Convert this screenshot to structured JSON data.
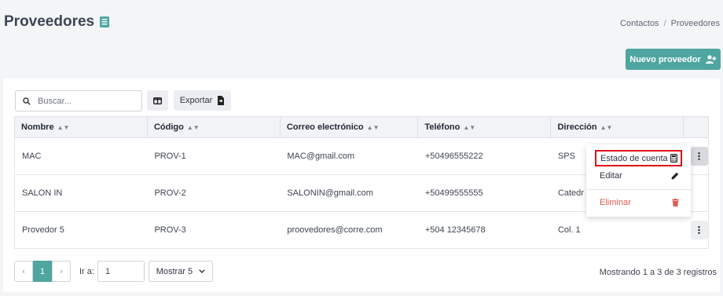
{
  "header": {
    "title": "Proveedores",
    "breadcrumb": [
      "Contactos",
      "Proveedores"
    ],
    "new_button": "Nuevo proveedor"
  },
  "toolbar": {
    "search_placeholder": "Buscar...",
    "export_label": "Exportar"
  },
  "table": {
    "columns": [
      "Nombre",
      "Código",
      "Correo electrónico",
      "Teléfono",
      "Dirección"
    ],
    "rows": [
      {
        "nombre": "MAC",
        "codigo": "PROV-1",
        "correo": "MAC@gmail.com",
        "telefono": "+50496555222",
        "direccion": "SPS"
      },
      {
        "nombre": "SALON IN",
        "codigo": "PROV-2",
        "correo": "SALONIN@gmail.com",
        "telefono": "+50499555555",
        "direccion": "Catedr"
      },
      {
        "nombre": "Provedor 5",
        "codigo": "PROV-3",
        "correo": "proovedores@corre.com",
        "telefono": "+504 12345678",
        "direccion": "Col. 1"
      }
    ]
  },
  "row_menu": {
    "items": [
      "Estado de cuenta",
      "Editar",
      "Eliminar"
    ]
  },
  "pagination": {
    "prev": "‹",
    "current_page": "1",
    "next": "›",
    "goto_label": "Ir a:",
    "goto_value": "1",
    "page_size_label": "Mostrar 5",
    "summary": "Mostrando 1 a 3 de 3 registros"
  },
  "colors": {
    "accent": "#4fa6a1",
    "danger": "#e05a52",
    "highlight_border": "#e30e18"
  }
}
